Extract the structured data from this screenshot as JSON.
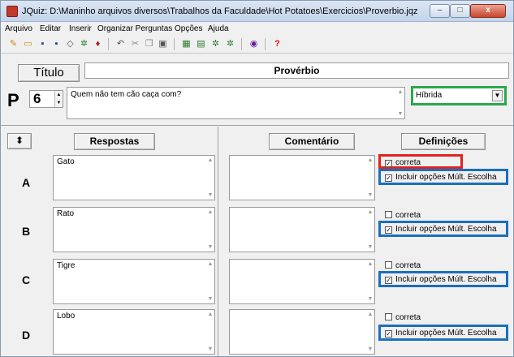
{
  "window": {
    "title": "JQuiz: D:\\Maninho arquivos diversos\\Trabalhos da Faculdade\\Hot Potatoes\\Exercicios\\Proverbio.jqz",
    "controls": {
      "minimize": "–",
      "maximize": "□",
      "close": "x"
    }
  },
  "menu": [
    "Arquivo",
    "Editar",
    "Inserir",
    "Organizar Perguntas",
    "Opções",
    "Ajuda"
  ],
  "toolbar": {
    "icons": [
      "new-icon",
      "open-icon",
      "save-icon",
      "save-as-icon",
      "eraser-icon",
      "web-export-icon",
      "add-question-icon",
      "undo-icon",
      "cut-icon",
      "copy-icon",
      "paste-icon",
      "config-icon",
      "web-page-icon",
      "tools-icon",
      "options-icon",
      "help-topics-icon",
      "help-icon"
    ]
  },
  "top": {
    "titulo_label": "Título",
    "title_value": "Provérbio",
    "p_label": "P",
    "question_number": "6",
    "question_text": "Quem não tem cão caça com?",
    "question_type": "Híbrida"
  },
  "columns": {
    "respostas": "Respostas",
    "comentario": "Comentário",
    "definicoes": "Definições"
  },
  "rows": [
    {
      "letter": "A",
      "answer": "Gato",
      "correta_label": "correta",
      "correta_checked": true,
      "incluir_label": "Incluir opções Múlt. Escolha",
      "incluir_checked": true
    },
    {
      "letter": "B",
      "answer": "Rato",
      "correta_label": "correta",
      "correta_checked": false,
      "incluir_label": "Incluir opções Múlt. Escolha",
      "incluir_checked": true
    },
    {
      "letter": "C",
      "answer": "Tigre",
      "correta_label": "correta",
      "correta_checked": false,
      "incluir_label": "Incluir opções Múlt. Escolha",
      "incluir_checked": true
    },
    {
      "letter": "D",
      "answer": "Lobo",
      "correta_label": "correta",
      "correta_checked": false,
      "incluir_label": "Incluir opções Múlt. Escolha",
      "incluir_checked": true
    }
  ],
  "colors": {
    "highlight_green": "#2aa84a",
    "highlight_red": "#e2231a",
    "highlight_blue": "#1a6fbf"
  }
}
